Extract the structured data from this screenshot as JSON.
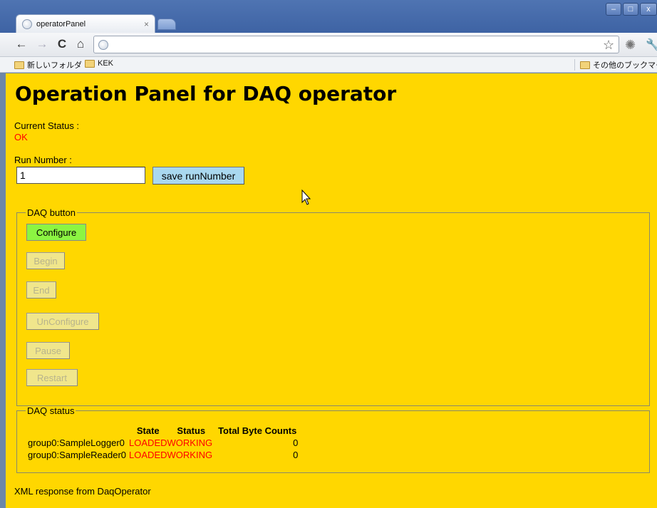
{
  "browser": {
    "tab_title": "operatorPanel",
    "tab_close": "×",
    "window_buttons": {
      "minimize": "–",
      "maximize": "□",
      "close": "x"
    },
    "nav": {
      "back": "←",
      "forward": "→",
      "reload": "C",
      "home": "⌂"
    },
    "address": "",
    "bookmarks": [
      "新しいフォルダ",
      "KEK"
    ],
    "other_bookmarks": "その他のブックマーク"
  },
  "page": {
    "title": "Operation Panel for DAQ operator",
    "current_status_label": "Current Status :",
    "current_status_value": "OK",
    "run_number_label": "Run Number :",
    "run_number_value": "1",
    "save_button": "save runNumber",
    "daq_button_legend": "DAQ button",
    "buttons": {
      "configure": "Configure",
      "begin": "Begin",
      "end": "End",
      "unconfigure": "UnConfigure",
      "pause": "Pause",
      "restart": "Restart"
    },
    "daq_status_legend": "DAQ status",
    "status_table": {
      "headers": [
        "",
        "State",
        "Status",
        "Total Byte Counts"
      ],
      "rows": [
        [
          "group0:SampleLogger0",
          "LOADED",
          "WORKING",
          "0"
        ],
        [
          "group0:SampleReader0",
          "LOADED",
          "WORKING",
          "0"
        ]
      ]
    },
    "xml_note": "XML response from DaqOperator"
  },
  "colors": {
    "page_background": "#ffd700",
    "status_red": "#ff0000",
    "configure_active": "#8cf542",
    "disabled_button": "#f0e68c",
    "save_button": "#a9d8ef"
  }
}
